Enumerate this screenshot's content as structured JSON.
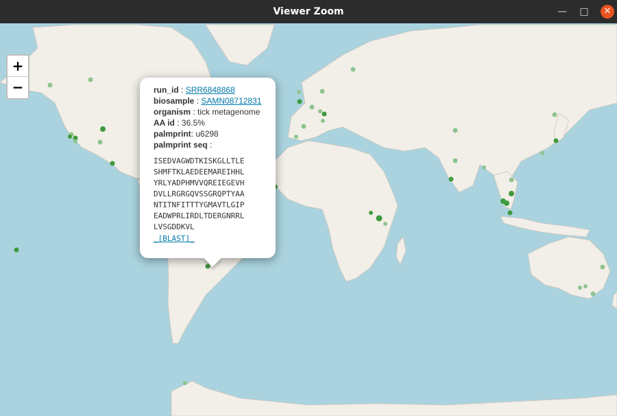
{
  "window": {
    "title": "Viewer Zoom",
    "minimize_label": "—",
    "maximize_label": "□",
    "close_label": "✕"
  },
  "zoom": {
    "in_label": "+",
    "out_label": "−"
  },
  "popup": {
    "run_id_label": "run_id",
    "run_id": "SRR6848868",
    "biosample_label": "biosample",
    "biosample": "SAMN08712831",
    "organism_label": "organism",
    "organism": "tick metagenome",
    "aa_id_label": "AA id",
    "aa_id": "36.5%",
    "palmprint_label": "palmprint",
    "palmprint": "u6298",
    "palmprint_seq_label": "palmprint seq",
    "sequence_lines": [
      "ISEDVAGWDTKISKGLLTLE",
      "SHMFTKLAEDEEMAREIHHL",
      "YRLYADPHMVVQREIEGEVH",
      "DVLLRGRGQVSSGRQPTYAA",
      "NTITNFITTTYGMAVTLGIP",
      "EADWPRLIRDLTDERGNRRL",
      "LVSGDDKVL"
    ],
    "blast_label": "_[BLAST]_"
  },
  "colors": {
    "ocean": "#aad3df",
    "land": "#f2efe9",
    "border": "#b49bb6",
    "marker_dark": "#3f9a3f",
    "marker_light": "#8fc48f"
  }
}
